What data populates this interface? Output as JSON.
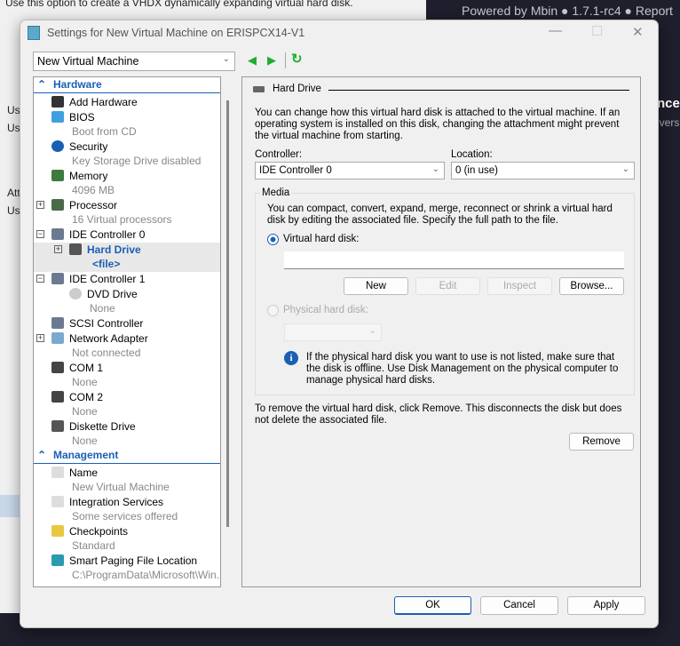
{
  "background": {
    "top_text": "Use this option to create a VHDX dynamically expanding virtual hard disk.",
    "fragments": [
      "Us",
      "Us",
      "Att",
      "Us"
    ],
    "powered_by": "Powered by Mbin  ●  1.7.1-rc4  ●  Report",
    "right_heading": "nce",
    "right_sub": "ivers"
  },
  "window": {
    "title": "Settings for New Virtual Machine on ERISPCX14-V1",
    "minimize": "—",
    "maximize": "☐",
    "close": "✕"
  },
  "vm_selector": {
    "value": "New Virtual Machine"
  },
  "tree": {
    "hardware_label": "Hardware",
    "management_label": "Management",
    "hardware": [
      {
        "label": "Add Hardware",
        "sub": ""
      },
      {
        "label": "BIOS",
        "sub": "Boot from CD"
      },
      {
        "label": "Security",
        "sub": "Key Storage Drive disabled"
      },
      {
        "label": "Memory",
        "sub": "4096 MB"
      },
      {
        "label": "Processor",
        "sub": "16 Virtual processors"
      },
      {
        "label": "IDE Controller 0",
        "sub": ""
      },
      {
        "label": "Hard Drive",
        "sub": "<file>"
      },
      {
        "label": "IDE Controller 1",
        "sub": ""
      },
      {
        "label": "DVD Drive",
        "sub": "None"
      },
      {
        "label": "SCSI Controller",
        "sub": ""
      },
      {
        "label": "Network Adapter",
        "sub": "Not connected"
      },
      {
        "label": "COM 1",
        "sub": "None"
      },
      {
        "label": "COM 2",
        "sub": "None"
      },
      {
        "label": "Diskette Drive",
        "sub": "None"
      }
    ],
    "management": [
      {
        "label": "Name",
        "sub": "New Virtual Machine"
      },
      {
        "label": "Integration Services",
        "sub": "Some services offered"
      },
      {
        "label": "Checkpoints",
        "sub": "Standard"
      },
      {
        "label": "Smart Paging File Location",
        "sub": "C:\\ProgramData\\Microsoft\\Win..."
      }
    ]
  },
  "panel": {
    "heading": "Hard Drive",
    "intro": "You can change how this virtual hard disk is attached to the virtual machine. If an operating system is installed on this disk, changing the attachment might prevent the virtual machine from starting.",
    "controller_label": "Controller:",
    "controller_value": "IDE Controller 0",
    "location_label": "Location:",
    "location_value": "0 (in use)",
    "media_label": "Media",
    "media_desc": "You can compact, convert, expand, merge, reconnect or shrink a virtual hard disk by editing the associated file. Specify the full path to the file.",
    "vhd_label": "Virtual hard disk:",
    "vhd_value": "",
    "new": "New",
    "edit": "Edit",
    "inspect": "Inspect",
    "browse": "Browse...",
    "phys_label": "Physical hard disk:",
    "info": "If the physical hard disk you want to use is not listed, make sure that the disk is offline. Use Disk Management on the physical computer to manage physical hard disks.",
    "remove_desc": "To remove the virtual hard disk, click Remove. This disconnects the disk but does not delete the associated file.",
    "remove": "Remove"
  },
  "footer": {
    "ok": "OK",
    "cancel": "Cancel",
    "apply": "Apply"
  },
  "colors": {
    "accent": "#1a5fb4",
    "nav_green": "#1fae2f"
  }
}
